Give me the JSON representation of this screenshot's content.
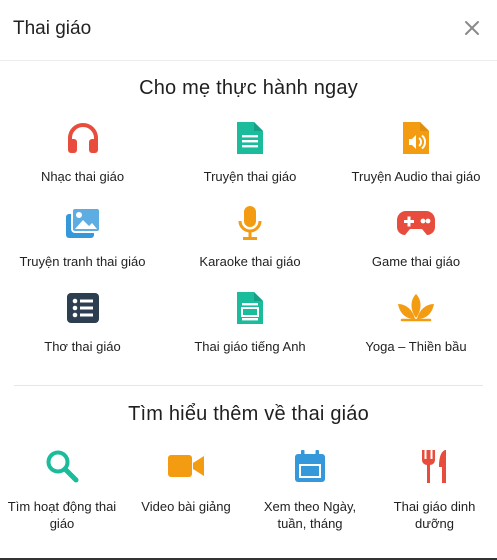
{
  "header": {
    "title": "Thai giáo",
    "close_icon": "close-icon"
  },
  "section1": {
    "title": "Cho mẹ thực hành ngay",
    "items": [
      {
        "label": "Nhạc thai giáo",
        "icon": "headphones-icon",
        "color": "#e74c3c"
      },
      {
        "label": "Truyện thai giáo",
        "icon": "document-icon",
        "color": "#1abc9c"
      },
      {
        "label": "Truyện Audio thai giáo",
        "icon": "audio-file-icon",
        "color": "#f39c12"
      },
      {
        "label": "Truyện tranh thai giáo",
        "icon": "images-icon",
        "color": "#3498db"
      },
      {
        "label": "Karaoke thai giáo",
        "icon": "microphone-icon",
        "color": "#f39c12"
      },
      {
        "label": "Game thai giáo",
        "icon": "gamepad-icon",
        "color": "#e74c3c"
      },
      {
        "label": "Thơ thai giáo",
        "icon": "list-icon",
        "color": "#2c3e50"
      },
      {
        "label": "Thai giáo tiếng Anh",
        "icon": "document-layout-icon",
        "color": "#1abc9c"
      },
      {
        "label": "Yoga – Thiền bầu",
        "icon": "lotus-icon",
        "color": "#f39c12"
      }
    ]
  },
  "section2": {
    "title": "Tìm hiểu thêm về thai giáo",
    "items": [
      {
        "label": "Tìm hoạt động thai giáo",
        "icon": "search-icon",
        "color": "#1abc9c"
      },
      {
        "label": "Video bài giảng",
        "icon": "video-camera-icon",
        "color": "#f39c12"
      },
      {
        "label": "Xem theo Ngày, tuần, tháng",
        "icon": "calendar-icon",
        "color": "#3498db"
      },
      {
        "label": "Thai giáo dinh dưỡng",
        "icon": "utensils-icon",
        "color": "#e74c3c"
      }
    ]
  }
}
